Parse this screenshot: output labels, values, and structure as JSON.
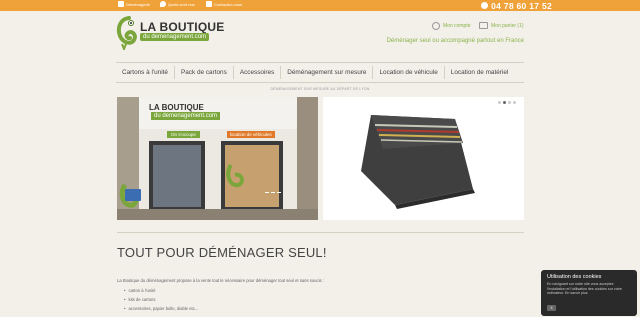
{
  "topbar": {
    "links": [
      "Déménagerie",
      "Quels sont nos",
      "Contactez-nous"
    ],
    "phone": "04 78 60 17 52"
  },
  "logo": {
    "line1": "LA BOUTIQUE",
    "line2": "du demenagement.com"
  },
  "account": {
    "my_account": "Mon compte",
    "my_cart": "Mon panier (1)"
  },
  "tagline": "Déménager seul ou accompagné partout en France",
  "nav": [
    "Cartons à l'unité",
    "Pack de cartons",
    "Accessoires",
    "Déménagement sur mesure",
    "Location de véhicule",
    "Location de matériel"
  ],
  "breadcrumb": "DÉMÉNAGEMENT SUR MESURE AU DÉPART DE LYON",
  "slider": {
    "active_index": 2,
    "count": 4
  },
  "storefront": {
    "sign1": "LA BOUTIQUE",
    "sign2": "du demenagement.com",
    "window1": "On s'occupe",
    "window2": "location de véhicules"
  },
  "heading": "TOUT POUR DÉMÉNAGER SEUL!",
  "intro": "La Boutique du déménagement propose à la vente tout le nécessaire pour déménager tout seul et sans soucis :",
  "bullets": [
    "carton à l'unité",
    "kits de cartons",
    "accessoires, papier bulle, diable etc..."
  ],
  "cookie": {
    "title": "Utilisation des cookies",
    "body": "En naviguant sur notre site vous acceptez l'installation et l'utilisation des cookies sur votre ordinateur. En savoir plus",
    "ok": "X"
  },
  "colors": {
    "accent_orange": "#f0a23a",
    "brand_green": "#8ab34b",
    "background": "#f3f0ea"
  }
}
